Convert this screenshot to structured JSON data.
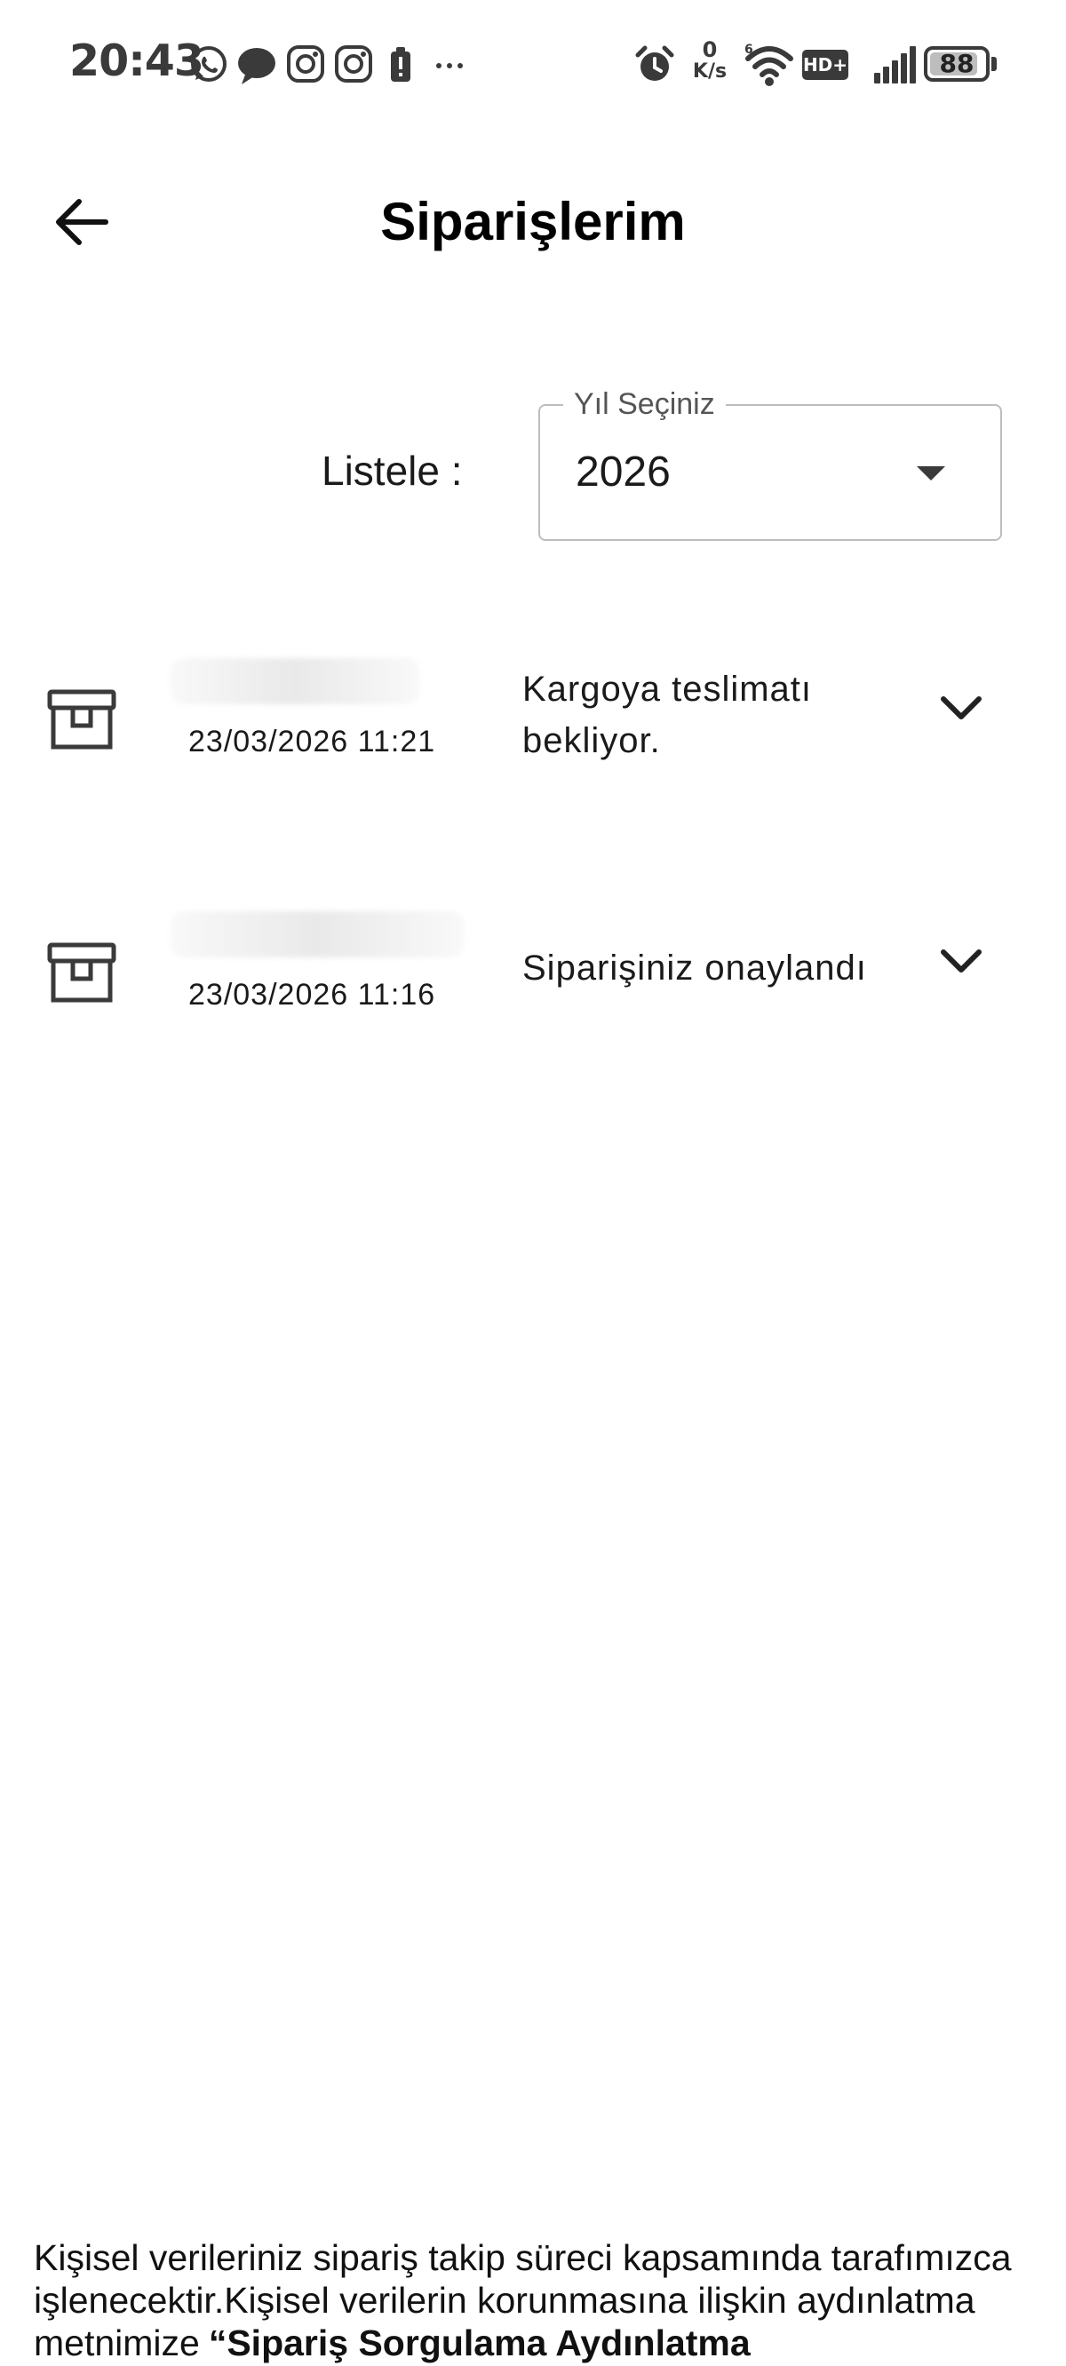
{
  "status_bar": {
    "time": "20:43",
    "notification_icons": [
      "whatsapp-icon",
      "chat-bubble-icon",
      "instagram-icon",
      "instagram-icon",
      "battery-saver-icon",
      "more-dots-icon"
    ],
    "net_speed_value": "0",
    "net_speed_unit": "K/s",
    "hd_label": "HD+",
    "battery_level": "88",
    "battery_fraction": 0.88
  },
  "header": {
    "title": "Siparişlerim",
    "back_icon": "arrow-left-icon"
  },
  "filter": {
    "label": "Listele :",
    "select_label": "Yıl Seçiniz",
    "selected_year": "2026"
  },
  "orders": [
    {
      "date": "23/03/2026 11:21",
      "status": "Kargoya teslimatı bekliyor.",
      "icon": "package-box-icon"
    },
    {
      "date": "23/03/2026 11:16",
      "status": "Siparişiniz onaylandı",
      "icon": "package-box-icon"
    }
  ],
  "footer": {
    "notice": "Kişisel verileriniz sipariş takip süreci kapsamında tarafımızca işlenecektir.Kişisel verilerin korunmasına ilişkin aydınlatma metnimize",
    "link_text": "“Sipariş Sorgulama Aydınlatma"
  },
  "colors": {
    "text": "#111111",
    "border": "#bdbdbd",
    "status_icons": "#3a3a3a"
  }
}
